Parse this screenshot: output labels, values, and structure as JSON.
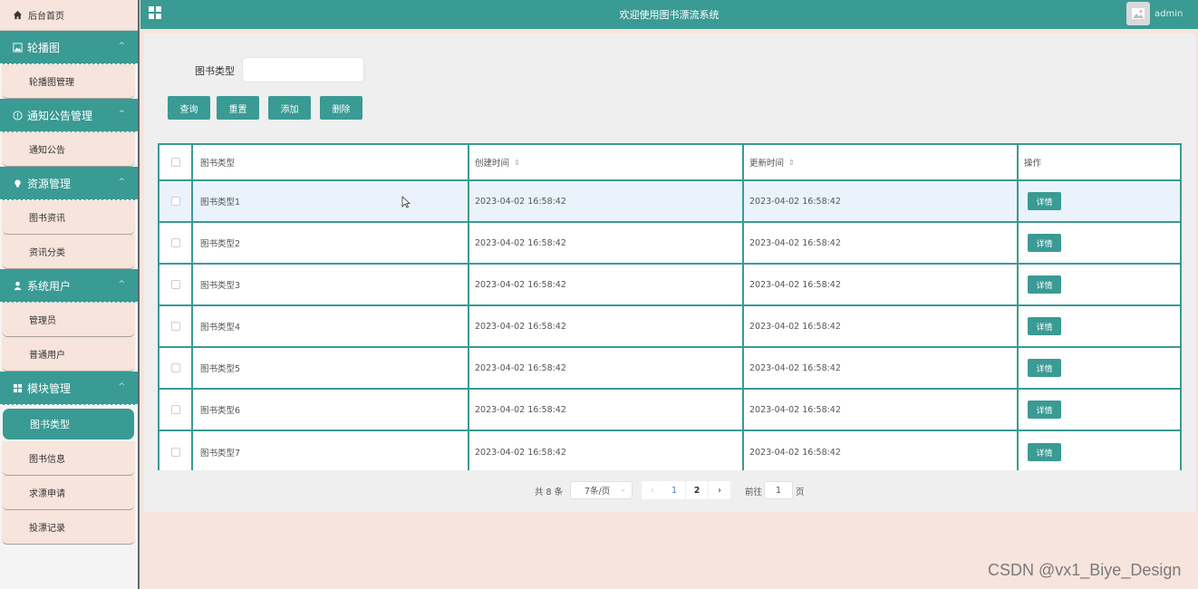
{
  "sidebar": {
    "home": {
      "label": "后台首页",
      "icon": "home-icon"
    },
    "groups": [
      {
        "label": "轮播图",
        "icon": "image-icon",
        "items": [
          {
            "label": "轮播图管理"
          }
        ]
      },
      {
        "label": "通知公告管理",
        "icon": "info-circle-icon",
        "items": [
          {
            "label": "通知公告"
          }
        ]
      },
      {
        "label": "资源管理",
        "icon": "bulb-icon",
        "items": [
          {
            "label": "图书资讯"
          },
          {
            "label": "资讯分类"
          }
        ]
      },
      {
        "label": "系统用户",
        "icon": "user-icon",
        "items": [
          {
            "label": "管理员"
          },
          {
            "label": "普通用户"
          }
        ]
      },
      {
        "label": "模块管理",
        "icon": "grid-icon",
        "items": [
          {
            "label": "图书类型",
            "active": true
          },
          {
            "label": "图书信息"
          },
          {
            "label": "求漂申请"
          },
          {
            "label": "投漂记录"
          }
        ]
      }
    ]
  },
  "header": {
    "title": "欢迎使用图书漂流系统",
    "username": "admin",
    "menu_icon": "grid-menu-icon",
    "avatar_icon": "image-avatar-icon"
  },
  "search": {
    "label": "图书类型",
    "value": ""
  },
  "buttons": {
    "query": "查询",
    "reset": "重置",
    "add": "添加",
    "delete": "删除"
  },
  "table": {
    "headers": {
      "type": "图书类型",
      "created": "创建时间",
      "updated": "更新时间",
      "action": "操作"
    },
    "rows": [
      {
        "type": "图书类型1",
        "created": "2023-04-02 16:58:42",
        "updated": "2023-04-02 16:58:42",
        "action": "详情"
      },
      {
        "type": "图书类型2",
        "created": "2023-04-02 16:58:42",
        "updated": "2023-04-02 16:58:42",
        "action": "详情"
      },
      {
        "type": "图书类型3",
        "created": "2023-04-02 16:58:42",
        "updated": "2023-04-02 16:58:42",
        "action": "详情"
      },
      {
        "type": "图书类型4",
        "created": "2023-04-02 16:58:42",
        "updated": "2023-04-02 16:58:42",
        "action": "详情"
      },
      {
        "type": "图书类型5",
        "created": "2023-04-02 16:58:42",
        "updated": "2023-04-02 16:58:42",
        "action": "详情"
      },
      {
        "type": "图书类型6",
        "created": "2023-04-02 16:58:42",
        "updated": "2023-04-02 16:58:42",
        "action": "详情"
      },
      {
        "type": "图书类型7",
        "created": "2023-04-02 16:58:42",
        "updated": "2023-04-02 16:58:42",
        "action": "详情"
      }
    ]
  },
  "pagination": {
    "total": "共 8 条",
    "page_size": "7条/页",
    "pages": [
      "1",
      "2"
    ],
    "current_page": "1",
    "goto_label": "前往",
    "goto_value": "1",
    "page_suffix": "页"
  },
  "watermark": "CSDN @vx1_Biye_Design",
  "colors": {
    "primary": "#3a9a94",
    "sidebar_bg": "#f7e4dc",
    "highlight_row": "#eaf3fb"
  }
}
